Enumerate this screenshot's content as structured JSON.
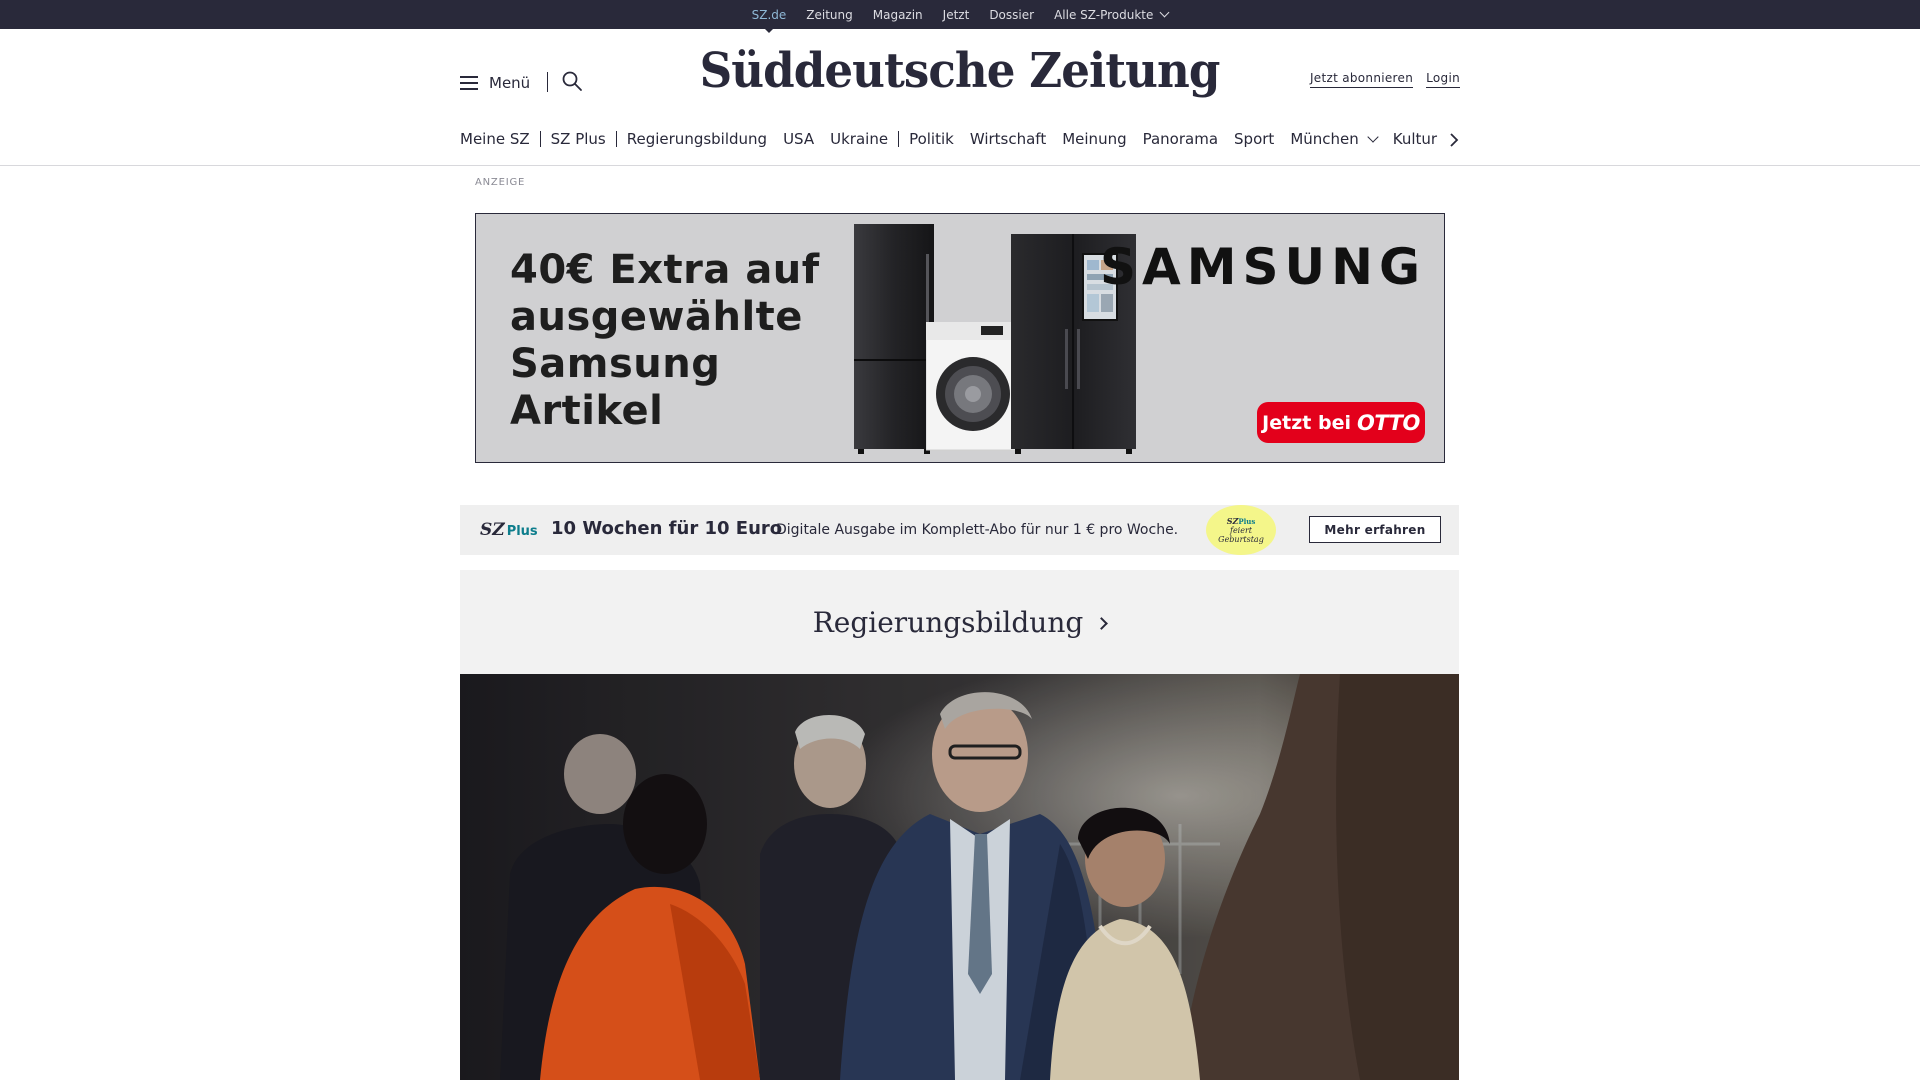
{
  "topbar": {
    "links": [
      {
        "label": "SZ.de",
        "active": true
      },
      {
        "label": "Zeitung"
      },
      {
        "label": "Magazin"
      },
      {
        "label": "Jetzt"
      },
      {
        "label": "Dossier"
      },
      {
        "label": "Alle SZ-Produkte",
        "has_dropdown": true
      }
    ]
  },
  "header": {
    "menu_label": "Menü",
    "logo_text": "Süddeutsche Zeitung",
    "subscribe_label": "Jetzt abonnieren",
    "login_label": "Login"
  },
  "nav": {
    "items": [
      "Meine SZ",
      "SZ Plus",
      "Regierungsbildung",
      "USA",
      "Ukraine",
      "Politik",
      "Wirtschaft",
      "Meinung",
      "Panorama",
      "Sport",
      "München",
      "Kultur"
    ]
  },
  "ad": {
    "label": "ANZEIGE",
    "headline": "40€ Extra auf ausgewählte Samsung Artikel",
    "brand": "SAMSUNG",
    "cta_prefix": "Jetzt bei",
    "cta_brand": "OTTO"
  },
  "promo": {
    "logo_sz": "SZ",
    "logo_plus": "Plus",
    "title": "10 Wochen für 10 Euro",
    "text": "Digitale Ausgabe im Komplett-Abo für nur 1 € pro Woche.",
    "badge_sz": "SZ",
    "badge_plus": "Plus",
    "badge_line1": "feiert",
    "badge_line2": "Geburtstag",
    "button_label": "Mehr erfahren"
  },
  "section": {
    "title": "Regierungsbildung"
  },
  "colors": {
    "topbar_bg": "#29293a",
    "active_link": "#8fb8d6",
    "otto_red": "#e3001b",
    "sz_plus_teal": "#0d7d8c",
    "badge_yellow": "#f4f68a"
  }
}
